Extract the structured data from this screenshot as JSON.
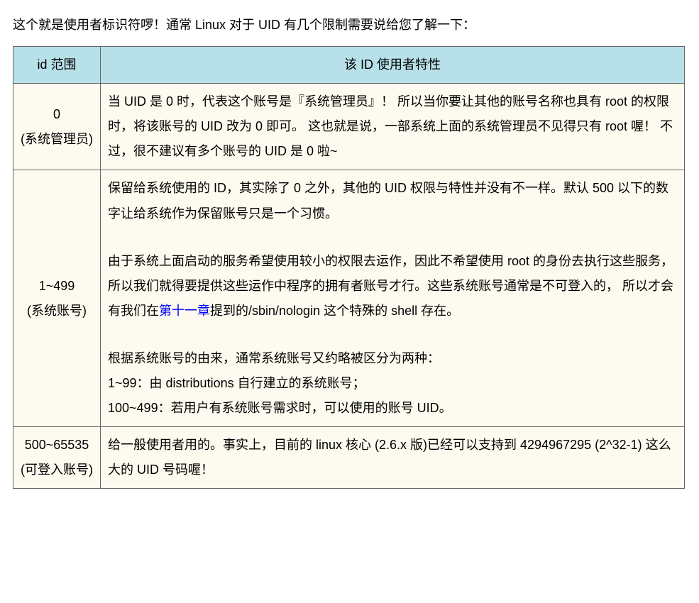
{
  "intro": "这个就是使用者标识符啰！通常 Linux 对于 UID 有几个限制需要说给您了解一下：",
  "headers": {
    "col1": "id 范围",
    "col2": "该 ID 使用者特性"
  },
  "rows": [
    {
      "range_line1": "0",
      "range_line2": "(系统管理员)",
      "desc_paras": [
        "当 UID 是 0 时，代表这个账号是『系统管理员』！ 所以当你要让其他的账号名称也具有 root 的权限时，将该账号的 UID 改为 0 即可。 这也就是说，一部系统上面的系统管理员不见得只有 root 喔！ 不过，很不建议有多个账号的 UID 是 0 啦~"
      ]
    },
    {
      "range_line1": "1~499",
      "range_line2": "(系统账号)",
      "desc_paras": [
        "保留给系统使用的 ID，其实除了 0 之外，其他的 UID 权限与特性并没有不一样。默认 500 以下的数字让给系统作为保留账号只是一个习惯。",
        "由于系统上面启动的服务希望使用较小的权限去运作，因此不希望使用 root 的身份去执行这些服务， 所以我们就得要提供这些运作中程序的拥有者账号才行。这些系统账号通常是不可登入的， 所以才会有我们在第十一章提到的/sbin/nologin 这个特殊的 shell 存在。",
        "根据系统账号的由来，通常系统账号又约略被区分为两种：\n1~99：由 distributions 自行建立的系统账号；\n100~499：若用户有系统账号需求时，可以使用的账号 UID。"
      ],
      "link_text": "第十一章"
    },
    {
      "range_line1": "500~65535",
      "range_line2": "(可登入账号)",
      "desc_paras": [
        "给一般使用者用的。事实上，目前的 linux 核心 (2.6.x 版)已经可以支持到 4294967295 (2^32-1) 这么大的 UID 号码喔！"
      ]
    }
  ]
}
